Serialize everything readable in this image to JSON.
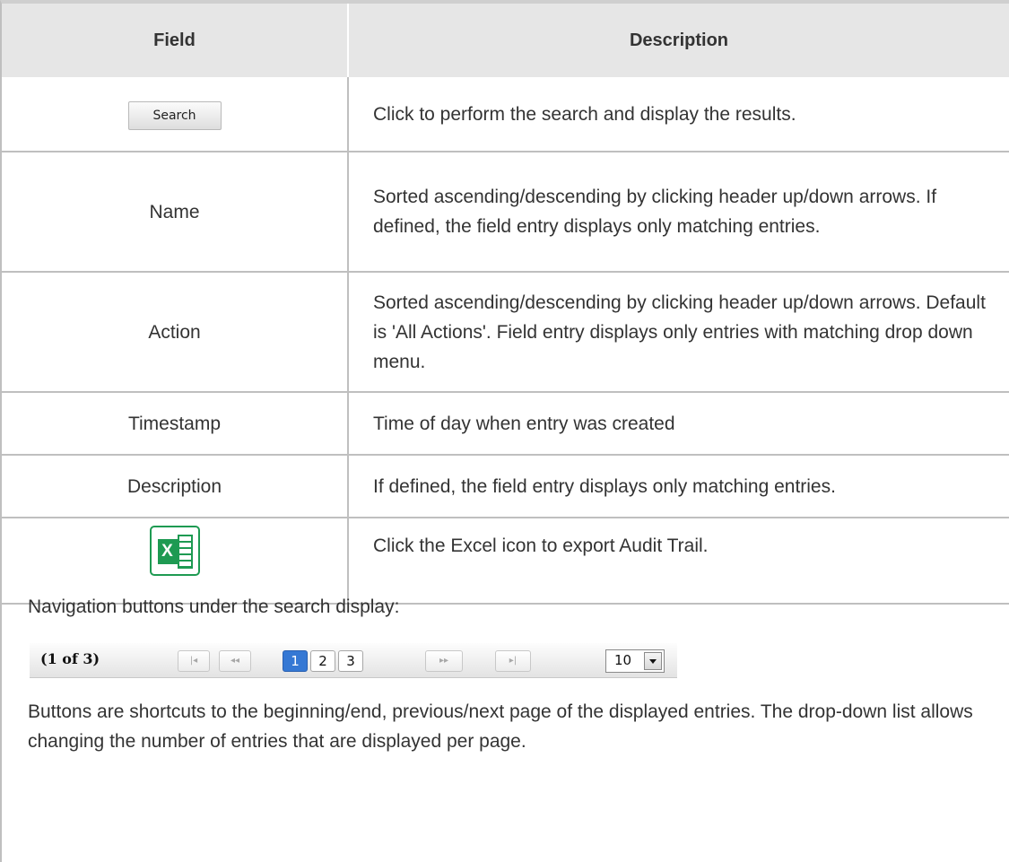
{
  "table": {
    "headers": {
      "field": "Field",
      "description": "Description"
    },
    "search_button_label": "Search",
    "rows": {
      "search": {
        "description": "Click to perform the search and display the results."
      },
      "name": {
        "field": "Name",
        "description": "Sorted ascending/descending by clicking header up/down arrows. If defined, the field entry displays only matching entries."
      },
      "action": {
        "field": "Action",
        "description": "Sorted ascending/descending by clicking header up/down arrows. Default is 'All Actions'. Field entry displays only entries with matching drop down menu."
      },
      "timestamp": {
        "field": "Timestamp",
        "description": "Time of day when entry was created"
      },
      "description": {
        "field": "Description",
        "description": "If defined, the field entry displays only matching entries."
      },
      "excel": {
        "icon_letter": "X",
        "description": "Click the Excel icon to export Audit Trail."
      }
    }
  },
  "note": {
    "lead": "Navigation buttons under the search display:",
    "pager": {
      "status": "(1 of 3)",
      "first_glyph": "|◂",
      "prev_glyph": "◂◂",
      "pages": [
        "1",
        "2",
        "3"
      ],
      "active_page": "1",
      "next_glyph": "▸▸",
      "last_glyph": "▸|",
      "rows_per_page": "10"
    },
    "explain": "Buttons are shortcuts to the beginning/end, previous/next page of the displayed entries. The drop-down list allows changing the number of entries that are displayed per page."
  },
  "icons": {
    "excel": "excel-icon",
    "dropdown": "chevron-down-icon"
  },
  "colors": {
    "header_bg": "#e6e6e6",
    "excel_green": "#1e9a52",
    "active_page": "#3578d4"
  }
}
